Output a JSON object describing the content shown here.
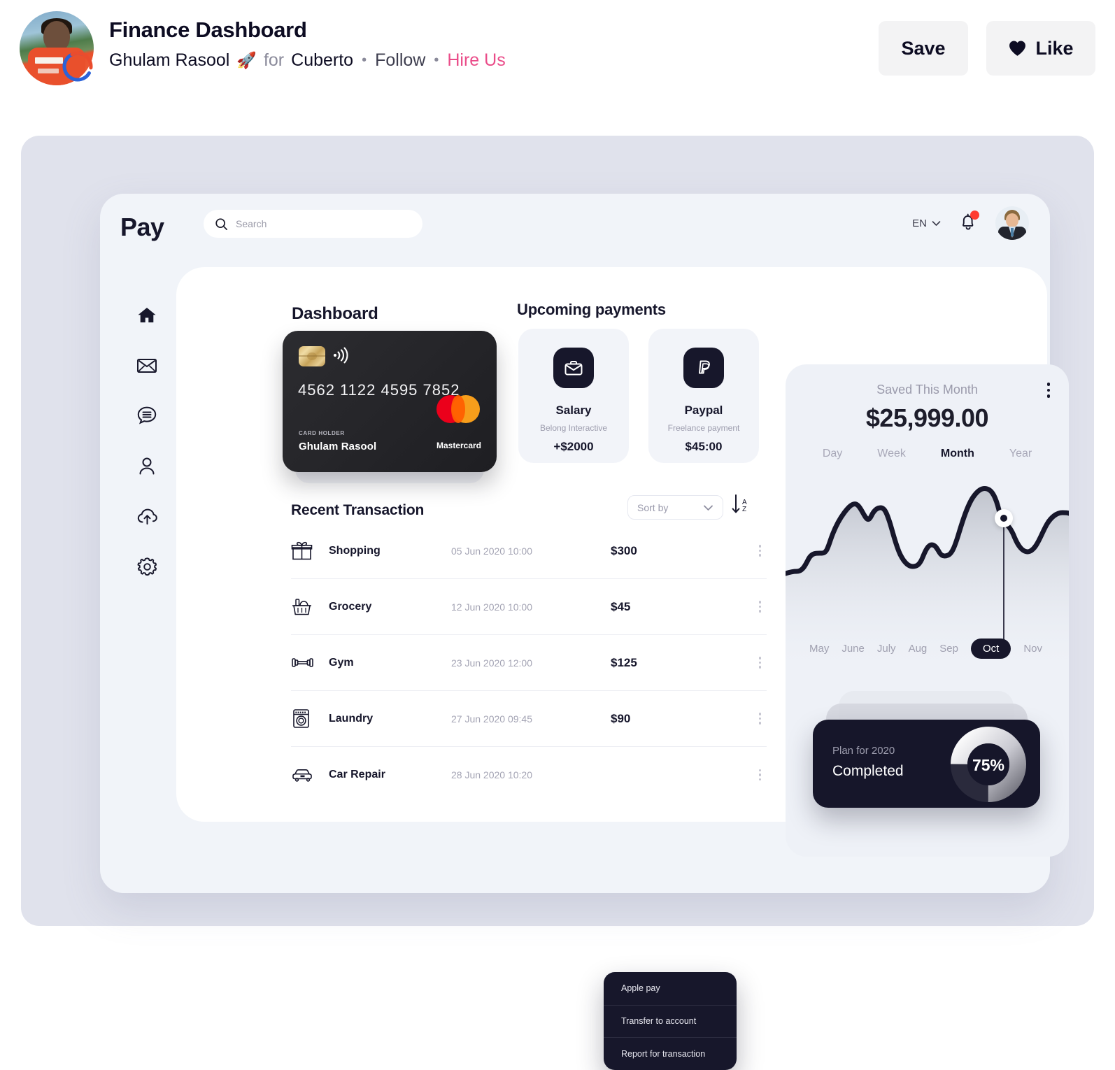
{
  "shot": {
    "title": "Finance Dashboard",
    "author": "Ghulam Rasool",
    "rocket": "🚀",
    "for_word": "for",
    "team": "Cuberto",
    "follow": "Follow",
    "hire": "Hire Us",
    "dot": "•",
    "save_label": "Save",
    "like_label": "Like",
    "accent_pink": "#ea4c89"
  },
  "app": {
    "logo": "Pay",
    "search": {
      "value": "",
      "placeholder": "Search"
    },
    "language": "EN",
    "sidebar": [
      {
        "icon": "home-icon",
        "name": "home"
      },
      {
        "icon": "mail-icon",
        "name": "mail"
      },
      {
        "icon": "chat-icon",
        "name": "chat"
      },
      {
        "icon": "user-icon",
        "name": "profile"
      },
      {
        "icon": "cloud-upload-icon",
        "name": "upload"
      },
      {
        "icon": "gear-icon",
        "name": "settings"
      }
    ]
  },
  "dashboard": {
    "title": "Dashboard",
    "card": {
      "number": "4562 1122 4595 7852",
      "holder_label": "CARD HOLDER",
      "holder": "Ghulam Rasool",
      "brand": "Mastercard"
    }
  },
  "upcoming": {
    "title": "Upcoming payments",
    "items": [
      {
        "icon": "briefcase-icon",
        "name": "Salary",
        "sub": "Belong Interactive",
        "amount": "+$2000"
      },
      {
        "icon": "paypal-icon",
        "name": "Paypal",
        "sub": "Freelance payment",
        "amount": "$45:00"
      }
    ]
  },
  "transactions": {
    "title": "Recent Transaction",
    "sort_placeholder": "Sort by",
    "az": {
      "a": "A",
      "z": "Z"
    },
    "rows": [
      {
        "icon": "gift-icon",
        "name": "Shopping",
        "date": "05 Jun 2020 10:00",
        "amount": "$300"
      },
      {
        "icon": "grocery-basket-icon",
        "name": "Grocery",
        "date": "12 Jun 2020 10:00",
        "amount": "$45"
      },
      {
        "icon": "dumbbell-icon",
        "name": "Gym",
        "date": "23 Jun 2020 12:00",
        "amount": "$125"
      },
      {
        "icon": "washing-machine-icon",
        "name": "Laundry",
        "date": "27 Jun 2020 09:45",
        "amount": "$90"
      },
      {
        "icon": "car-icon",
        "name": "Car Repair",
        "date": "28 Jun  2020 10:20",
        "amount": ""
      }
    ]
  },
  "context_menu": {
    "items": [
      "Apple pay",
      "Transfer to  account",
      "Report for transaction"
    ]
  },
  "savings": {
    "label": "Saved This Month",
    "amount": "$25,999.00",
    "tabs": [
      {
        "label": "Day",
        "active": false
      },
      {
        "label": "Week",
        "active": false
      },
      {
        "label": "Month",
        "active": true
      },
      {
        "label": "Year",
        "active": false
      }
    ],
    "months": [
      {
        "label": "May",
        "active": false
      },
      {
        "label": "June",
        "active": false
      },
      {
        "label": "July",
        "active": false
      },
      {
        "label": "Aug",
        "active": false
      },
      {
        "label": "Sep",
        "active": false
      },
      {
        "label": "Oct",
        "active": true
      },
      {
        "label": "Nov",
        "active": false
      }
    ]
  },
  "plan": {
    "subtitle": "Plan for 2020",
    "status": "Completed",
    "percent": "75%"
  },
  "chart_data": {
    "type": "area",
    "title": "Saved This Month",
    "xlabel": "",
    "ylabel": "",
    "categories": [
      "May",
      "June",
      "July",
      "Aug",
      "Sep",
      "Oct",
      "Nov"
    ],
    "highlight": "Oct",
    "highlight_value": 72,
    "values": [
      28,
      30,
      55,
      78,
      68,
      74,
      48,
      35,
      33,
      42,
      38,
      60,
      92,
      88,
      72,
      65,
      50,
      38,
      58,
      80
    ],
    "ylim": [
      0,
      100
    ],
    "grid": false,
    "legend": false
  }
}
